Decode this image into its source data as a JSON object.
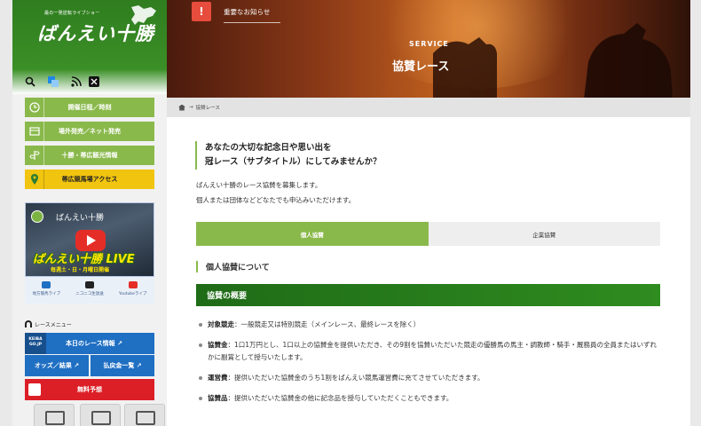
{
  "sidebar": {
    "logo_tagline": "最の一発逆転ライブショー",
    "logo_text": "ばんえい十勝",
    "nav": [
      {
        "label": "開催日程／時刻",
        "icon": "clock-icon"
      },
      {
        "label": "場外発売／ネット発売",
        "icon": "ticket-icon"
      },
      {
        "label": "十勝・帯広観光情報",
        "icon": "signpost-icon"
      },
      {
        "label": "帯広競馬場アクセス",
        "icon": "map-pin-icon"
      }
    ],
    "live_banner": {
      "title": "ばんえい十勝",
      "big": "ばんえい十勝 LIVE",
      "sub": "毎週土・日・月曜日開催"
    },
    "streams": [
      "地方競馬ライブ",
      "ニコニコ生放送",
      "Youtubeライブ"
    ],
    "race_menu_label": "レースメニュー",
    "keiba_badge": "KEIBA GO.JP",
    "today_race": "本日のレース情報 ↗",
    "odds": "オッズ／結果 ↗",
    "payout": "払戻金一覧 ↗",
    "free_pick": "無料予想"
  },
  "hero": {
    "notice": "重要なお知らせ",
    "notice_icon": "!",
    "section_en": "SERVICE",
    "section_jp": "協賛レース"
  },
  "breadcrumb": {
    "arrow": "→",
    "current": "協賛レース"
  },
  "content": {
    "lead_line1": "あなたの大切な記念日や思い出を",
    "lead_line2": "冠レース（サブタイトル）にしてみませんか？",
    "intro1": "ばんえい十勝のレース協賛を募集します。",
    "intro2": "個人または団体などどなたでも申込みいただけます。",
    "tabs": [
      "個人協賛",
      "企業協賛"
    ],
    "section_heading": "個人協賛について",
    "bar_heading": "協賛の概要",
    "bullets": [
      {
        "term": "対象競走",
        "body": "：一般競走又は特別競走（メインレース、最終レースを除く）"
      },
      {
        "term": "協賛金",
        "body": "：1口1万円とし、1口以上の協賛金を提供いただき、その9割を協賛いただいた競走の優勝馬の馬主・調教師・騎手・厩務員の全員またはいずれかに副賞として授与いたします。"
      },
      {
        "term": "運営費",
        "body": "：提供いただいた協賛金のうち1割をばんえい競馬運営費に充てさせていただきます。"
      },
      {
        "term": "協賛品",
        "body": "：提供いただいた協賛金の他に記念品を授与していただくこともできます。"
      }
    ]
  },
  "colors": {
    "green": "#8ab94b",
    "dark_green": "#1f6b17",
    "yellow": "#f1c40f",
    "blue": "#1f6fc3",
    "red": "#dc1f26"
  }
}
